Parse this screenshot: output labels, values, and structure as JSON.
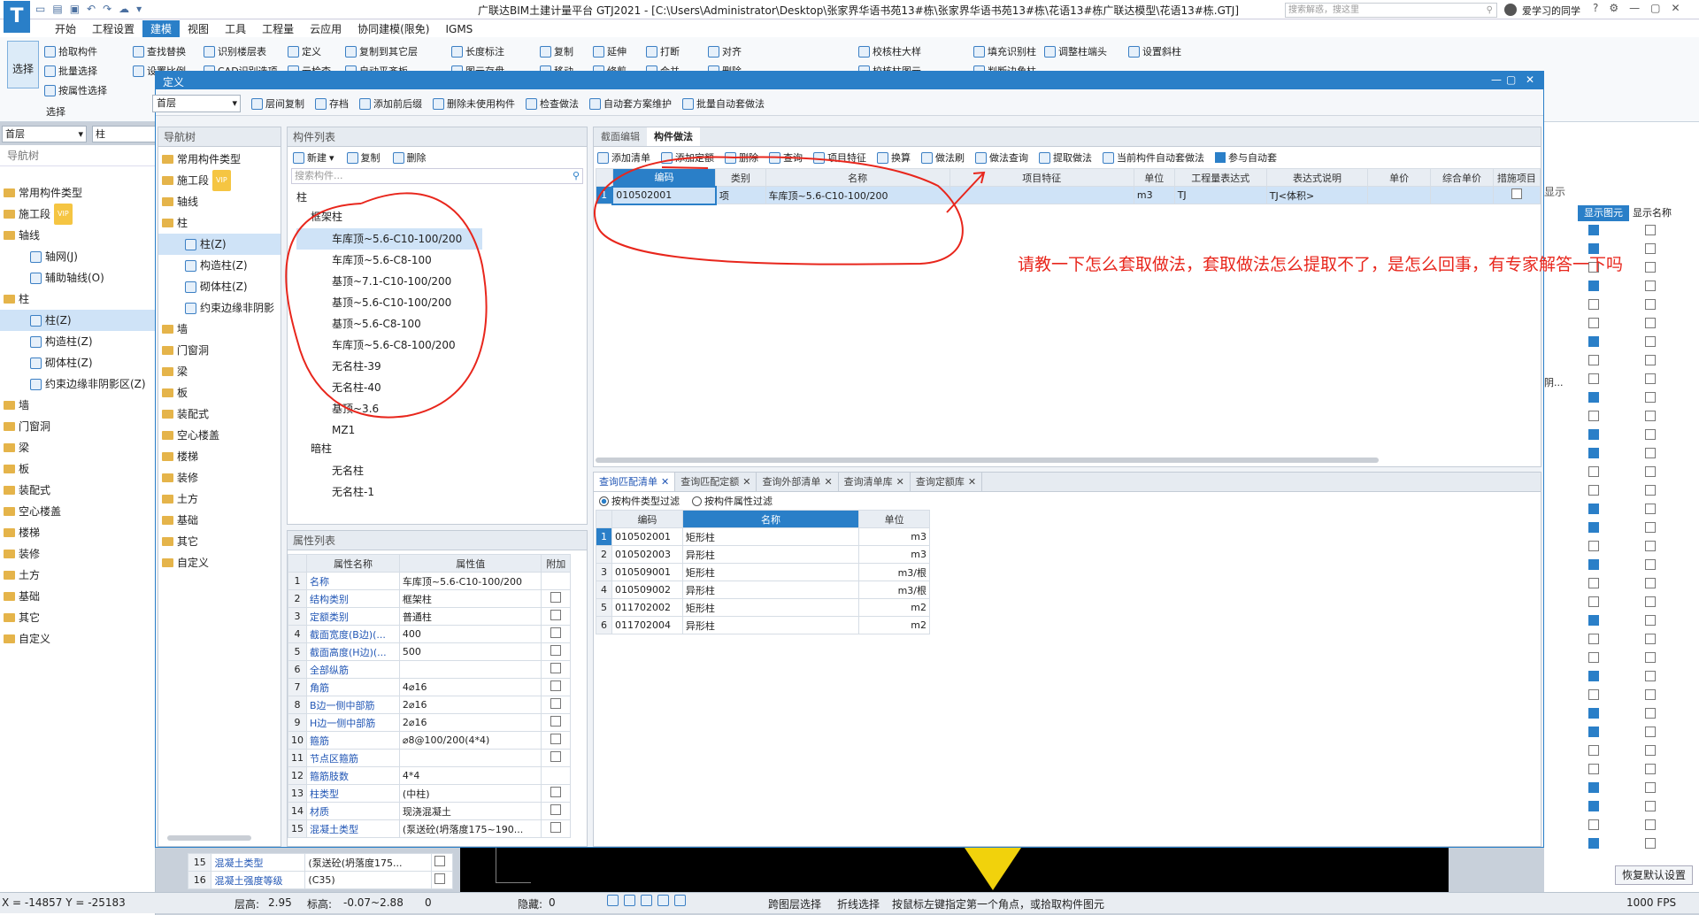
{
  "title_bar": {
    "title": "广联达BIM土建计量平台 GTJ2021 - [C:\\Users\\Administrator\\Desktop\\张家界华语书苑13#栋\\张家界华语书苑13#栋\\花语13#栋广联达模型\\花语13#栋.GTJ]",
    "search_placeholder": "搜索解惑，搜这里",
    "user": "爱学习的同学"
  },
  "menu": [
    "开始",
    "工程设置",
    "建模",
    "视图",
    "工具",
    "工程量",
    "云应用",
    "协同建模(限免)",
    "IGMS"
  ],
  "menu_active": "建模",
  "ribbon": {
    "select_label": "选择",
    "group_select": "选择",
    "row1": [
      "拾取构件",
      "查找替换",
      "识别楼层表",
      "定义",
      "复制到其它层",
      "长度标注",
      "复制",
      "延伸",
      "打断",
      "对齐",
      "校核柱大样",
      "填充识别柱",
      "调整柱端头",
      "设置斜柱"
    ],
    "row2": [
      "批量选择",
      "设置比例",
      "CAD识别选项",
      "云检查",
      "自动平齐板",
      "图元存盘",
      "移动",
      "修剪",
      "合并",
      "删除",
      "校核柱图元",
      "判断边角柱"
    ],
    "row3": [
      "按属性选择"
    ]
  },
  "floor_select": {
    "floor": "首层",
    "type": "柱"
  },
  "nav_tree": {
    "header": "导航树",
    "items": [
      {
        "label": "常用构件类型",
        "level": 0
      },
      {
        "label": "施工段",
        "level": 0,
        "badge": "VIP"
      },
      {
        "label": "轴线",
        "level": 0
      },
      {
        "label": "轴网(J)",
        "level": 1
      },
      {
        "label": "辅助轴线(O)",
        "level": 1
      },
      {
        "label": "柱",
        "level": 0
      },
      {
        "label": "柱(Z)",
        "level": 1,
        "selected": true
      },
      {
        "label": "构造柱(Z)",
        "level": 1
      },
      {
        "label": "砌体柱(Z)",
        "level": 1
      },
      {
        "label": "约束边缘非阴影区(Z)",
        "level": 1
      },
      {
        "label": "墙",
        "level": 0
      },
      {
        "label": "门窗洞",
        "level": 0
      },
      {
        "label": "梁",
        "level": 0
      },
      {
        "label": "板",
        "level": 0
      },
      {
        "label": "装配式",
        "level": 0
      },
      {
        "label": "空心楼盖",
        "level": 0
      },
      {
        "label": "楼梯",
        "level": 0
      },
      {
        "label": "装修",
        "level": 0
      },
      {
        "label": "土方",
        "level": 0
      },
      {
        "label": "基础",
        "level": 0
      },
      {
        "label": "其它",
        "level": 0
      },
      {
        "label": "自定义",
        "level": 0
      }
    ]
  },
  "dialog": {
    "title": "定义",
    "floor": "首层",
    "toolbar": [
      "层间复制",
      "存档",
      "添加前后缀",
      "删除未使用构件",
      "检查做法",
      "自动套方案维护",
      "批量自动套做法"
    ],
    "nav_header": "导航树",
    "nav_items": [
      {
        "label": "常用构件类型",
        "level": 0
      },
      {
        "label": "施工段",
        "level": 0,
        "badge": "VIP"
      },
      {
        "label": "轴线",
        "level": 0
      },
      {
        "label": "柱",
        "level": 0
      },
      {
        "label": "柱(Z)",
        "level": 1,
        "selected": true
      },
      {
        "label": "构造柱(Z)",
        "level": 1
      },
      {
        "label": "砌体柱(Z)",
        "level": 1
      },
      {
        "label": "约束边缘非阴影",
        "level": 1
      },
      {
        "label": "墙",
        "level": 0
      },
      {
        "label": "门窗洞",
        "level": 0
      },
      {
        "label": "梁",
        "level": 0
      },
      {
        "label": "板",
        "level": 0
      },
      {
        "label": "装配式",
        "level": 0
      },
      {
        "label": "空心楼盖",
        "level": 0
      },
      {
        "label": "楼梯",
        "level": 0
      },
      {
        "label": "装修",
        "level": 0
      },
      {
        "label": "土方",
        "level": 0
      },
      {
        "label": "基础",
        "level": 0
      },
      {
        "label": "其它",
        "level": 0
      },
      {
        "label": "自定义",
        "level": 0
      }
    ],
    "component_list": {
      "header": "构件列表",
      "new": "新建",
      "copy": "复制",
      "delete": "删除",
      "search_placeholder": "搜索构件...",
      "group_root": "柱",
      "group_frame": "框架柱",
      "frame_items": [
        "车库顶~5.6-C10-100/200",
        "车库顶~5.6-C8-100",
        "基顶~7.1-C10-100/200",
        "基顶~5.6-C10-100/200",
        "基顶~5.6-C8-100",
        "车库顶~5.6-C8-100/200",
        "无名柱-39",
        "无名柱-40",
        "基顶~3.6",
        "MZ1"
      ],
      "group_hidden": "暗柱",
      "hidden_items": [
        "无名柱",
        "无名柱-1"
      ]
    },
    "properties": {
      "header": "属性列表",
      "columns": [
        "属性名称",
        "属性值",
        "附加"
      ],
      "rows": [
        {
          "n": "1",
          "name": "名称",
          "value": "车库顶~5.6-C10-100/200",
          "cb": false,
          "show_cb": false
        },
        {
          "n": "2",
          "name": "结构类别",
          "value": "框架柱",
          "cb": false,
          "show_cb": true
        },
        {
          "n": "3",
          "name": "定额类别",
          "value": "普通柱",
          "cb": false,
          "show_cb": true
        },
        {
          "n": "4",
          "name": "截面宽度(B边)(...",
          "value": "400",
          "cb": false,
          "show_cb": true
        },
        {
          "n": "5",
          "name": "截面高度(H边)(...",
          "value": "500",
          "cb": false,
          "show_cb": true
        },
        {
          "n": "6",
          "name": "全部纵筋",
          "value": "",
          "cb": false,
          "show_cb": true
        },
        {
          "n": "7",
          "name": "角筋",
          "value": "4⌀16",
          "cb": false,
          "show_cb": true
        },
        {
          "n": "8",
          "name": "B边一侧中部筋",
          "value": "2⌀16",
          "cb": false,
          "show_cb": true
        },
        {
          "n": "9",
          "name": "H边一侧中部筋",
          "value": "2⌀16",
          "cb": false,
          "show_cb": true
        },
        {
          "n": "10",
          "name": "箍筋",
          "value": "⌀8@100/200(4*4)",
          "cb": false,
          "show_cb": true
        },
        {
          "n": "11",
          "name": "节点区箍筋",
          "value": "",
          "cb": false,
          "show_cb": true
        },
        {
          "n": "12",
          "name": "箍筋肢数",
          "value": "4*4",
          "cb": false,
          "show_cb": false
        },
        {
          "n": "13",
          "name": "柱类型",
          "value": "(中柱)",
          "cb": false,
          "show_cb": true
        },
        {
          "n": "14",
          "name": "材质",
          "value": "现浇混凝土",
          "cb": false,
          "show_cb": true
        },
        {
          "n": "15",
          "name": "混凝土类型",
          "value": "(泵送砼(坍落度175~190...",
          "cb": false,
          "show_cb": true
        }
      ]
    },
    "behind_rows": [
      {
        "n": "15",
        "name": "混凝土类型",
        "value": "(泵送砼(坍落度175..."
      },
      {
        "n": "16",
        "name": "混凝土强度等级",
        "value": "(C35)"
      }
    ],
    "method": {
      "tabs": [
        "截面编辑",
        "构件做法"
      ],
      "active_tab": "构件做法",
      "toolbar": [
        "添加清单",
        "添加定额",
        "删除",
        "查询",
        "项目特征",
        "换算",
        "做法刷",
        "做法查询",
        "提取做法",
        "当前构件自动套做法",
        "参与自动套"
      ],
      "columns": [
        "编码",
        "类别",
        "名称",
        "项目特征",
        "单位",
        "工程量表达式",
        "表达式说明",
        "单价",
        "综合单价",
        "措施项目"
      ],
      "rows": [
        {
          "n": "1",
          "code": "010502001",
          "cat": "项",
          "name": "车库顶~5.6-C10-100/200",
          "feature": "",
          "unit": "m3",
          "expr": "TJ",
          "desc": "TJ<体积>"
        }
      ]
    },
    "query": {
      "tabs": [
        "查询匹配清单",
        "查询匹配定额",
        "查询外部清单",
        "查询清单库",
        "查询定额库"
      ],
      "filter1": "按构件类型过滤",
      "filter2": "按构件属性过滤",
      "columns": [
        "编码",
        "名称",
        "单位"
      ],
      "rows": [
        {
          "n": "1",
          "code": "010502001",
          "name": "矩形柱",
          "unit": "m3"
        },
        {
          "n": "2",
          "code": "010502003",
          "name": "异形柱",
          "unit": "m3"
        },
        {
          "n": "3",
          "code": "010509001",
          "name": "矩形柱",
          "unit": "m3/根"
        },
        {
          "n": "4",
          "code": "010509002",
          "name": "异形柱",
          "unit": "m3/根"
        },
        {
          "n": "5",
          "code": "011702002",
          "name": "矩形柱",
          "unit": "m2"
        },
        {
          "n": "6",
          "code": "011702004",
          "name": "异形柱",
          "unit": "m2"
        }
      ]
    }
  },
  "annotation": "请教一下怎么套取做法，套取做法怎么提取不了，是怎么回事，有专家解答一下吗",
  "right_panel": {
    "tab": "显示",
    "col1": "显示图元",
    "col2": "显示名称",
    "side_text": "阴...",
    "restore_button": "恢复默认设置"
  },
  "status": {
    "coords": "X = -14857 Y = -25183",
    "floor_height_label": "层高:",
    "floor_height": "2.95",
    "elevation_label": "标高:",
    "elevation": "-0.07~2.88",
    "count": "0",
    "hidden_label": "隐藏:",
    "hidden": "0",
    "cross_layer": "跨图层选择",
    "polyline": "折线选择",
    "hint": "按鼠标左键指定第一个角点，或拾取构件图元",
    "fps": "1000 FPS"
  },
  "colors": {
    "accent": "#2a7fc8",
    "annotation": "#e8261c",
    "selected_row": "#cfe3f7",
    "link": "#2156b5"
  }
}
